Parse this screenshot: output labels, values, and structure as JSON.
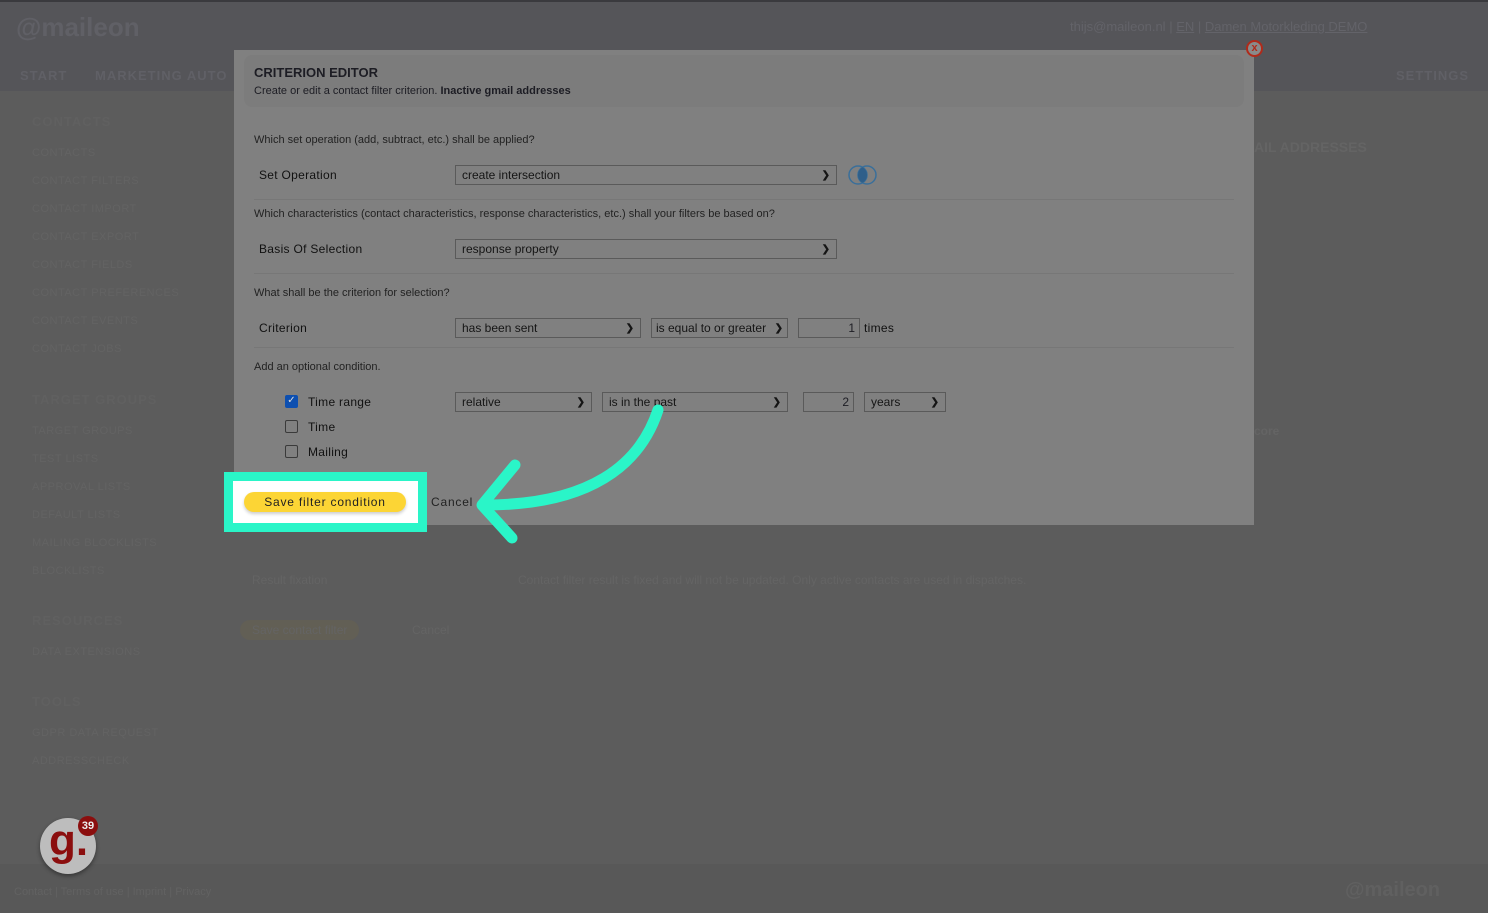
{
  "header": {
    "logo": "@maileon",
    "user": "thijs@maileon.nl",
    "lang": "EN",
    "account": "Damen Motorkleding DEMO",
    "nav": [
      "START",
      "MARKETING AUTO",
      "SETTINGS"
    ]
  },
  "sidebar": {
    "groups": [
      {
        "title": "CONTACTS",
        "items": [
          "CONTACTS",
          "CONTACT FILTERS",
          "CONTACT IMPORT",
          "CONTACT EXPORT",
          "CONTACT FIELDS",
          "CONTACT PREFERENCES",
          "CONTACT EVENTS",
          "CONTACT JOBS"
        ]
      },
      {
        "title": "TARGET GROUPS",
        "items": [
          "TARGET GROUPS",
          "TEST LISTS",
          "APPROVAL LISTS",
          "DEFAULT LISTS",
          "MAILING BLOCKLISTS",
          "BLOCKLISTS"
        ]
      },
      {
        "title": "RESOURCES",
        "items": [
          "DATA EXTENSIONS"
        ]
      },
      {
        "title": "TOOLS",
        "items": [
          "GDPR DATA REQUEST",
          "ADDRESSCHECK"
        ]
      }
    ]
  },
  "background": {
    "page_title_fragment": "AIL ADDRESSES",
    "score_fragment": "core",
    "result_fixation_label": "Result fixation",
    "result_fixation_text": "Contact filter result is fixed and will not be updated. Only active contacts are used in dispatches.",
    "save_contact_filter": "Save contact filter",
    "cancel": "Cancel"
  },
  "footer": {
    "links": "Contact | Terms of use | Imprint | Privacy",
    "logo": "@maileon"
  },
  "dialog": {
    "title": "CRITERION EDITOR",
    "subtitle": "Create or edit a contact filter criterion.",
    "filter_name": "Inactive gmail addresses",
    "q1": "Which set operation (add, subtract, etc.) shall be applied?",
    "set_operation_label": "Set Operation",
    "set_operation_value": "create intersection",
    "q2": "Which characteristics (contact characteristics, response characteristics, etc.) shall your filters be based on?",
    "basis_label": "Basis Of Selection",
    "basis_value": "response property",
    "q3": "What shall be the criterion for selection?",
    "criterion_label": "Criterion",
    "criterion_value": "has been sent",
    "comparator_value": "is equal to or greater",
    "count_value": "1",
    "count_unit": "times",
    "q4": "Add an optional condition.",
    "conditions": [
      {
        "label": "Time range",
        "checked": true
      },
      {
        "label": "Time",
        "checked": false
      },
      {
        "label": "Mailing",
        "checked": false
      }
    ],
    "time_mode": "relative",
    "time_relation": "is in the past",
    "time_amount": "2",
    "time_unit": "years",
    "save_label": "Save filter condition",
    "cancel_label": "Cancel"
  },
  "notification_badge": {
    "count": "39",
    "letter": "g."
  },
  "colors": {
    "highlight": "#2af5c8",
    "save_button": "#fcd535",
    "close": "#b02a1a"
  }
}
